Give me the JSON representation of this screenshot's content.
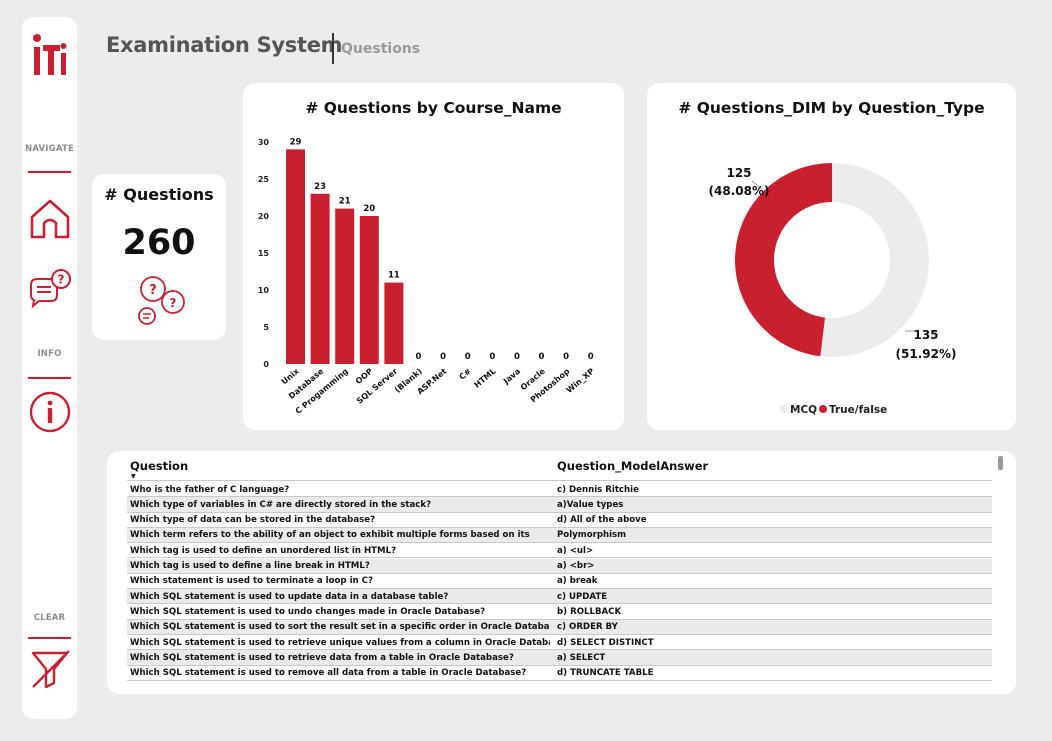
{
  "header": {
    "title": "Examination System",
    "subtitle": "Questions"
  },
  "sidebar": {
    "navigate_label": "NAVIGATE",
    "info_label": "INFO",
    "clear_label": "CLEAR"
  },
  "kpi": {
    "title": "# Questions",
    "value": "260"
  },
  "colors": {
    "accent": "#c8202f",
    "muted": "#ececec",
    "background": "#ececec"
  },
  "chart_data": [
    {
      "type": "bar",
      "title": "# Questions by Course_Name",
      "categories": [
        "Unix",
        "Database",
        "C Progamming",
        "OOP",
        "SQL Server",
        "(Blank)",
        "ASP.Net",
        "C#",
        "HTML",
        "Java",
        "Oracle",
        "Photoshop",
        "Win_XP"
      ],
      "values": [
        29,
        23,
        21,
        20,
        11,
        0,
        0,
        0,
        0,
        0,
        0,
        0,
        0
      ],
      "yticks": [
        0,
        5,
        10,
        15,
        20,
        25,
        30
      ],
      "ylim": [
        0,
        30
      ],
      "color": "#c8202f"
    },
    {
      "type": "pie",
      "title": "# Questions_DIM by Question_Type",
      "categories": [
        "MCQ",
        "True/false"
      ],
      "values": [
        135,
        125
      ],
      "labels": [
        [
          "135",
          "(51.92%)"
        ],
        [
          "125",
          "(48.08%)"
        ]
      ],
      "colors": [
        "#ececec",
        "#c8202f"
      ],
      "legend": "bottom"
    }
  ],
  "table": {
    "columns": [
      "Question",
      "Question_ModelAnswer"
    ],
    "rows": [
      [
        "Who is the father of C language?",
        "c) Dennis Ritchie"
      ],
      [
        "Which type of variables in C# are directly stored in the stack?",
        "a)Value types"
      ],
      [
        "Which type of data can be stored in the database?",
        "d) All of the above"
      ],
      [
        "Which term refers to the ability of an object to exhibit multiple forms based on its",
        "Polymorphism"
      ],
      [
        "Which tag is used to define an unordered list in HTML?",
        "a) <ul>"
      ],
      [
        "Which tag is used to define a line break in HTML?",
        "a) <br>"
      ],
      [
        "Which statement is used to terminate a loop in C?",
        "a) break"
      ],
      [
        "Which SQL statement is used to update data in a database table?",
        "c) UPDATE"
      ],
      [
        "Which SQL statement is used to undo changes made in Oracle Database?",
        "b) ROLLBACK"
      ],
      [
        "Which SQL statement is used to sort the result set in a specific order in Oracle Database?",
        "c) ORDER BY"
      ],
      [
        "Which SQL statement is used to retrieve unique values from a column in Oracle Database?",
        "d) SELECT DISTINCT"
      ],
      [
        "Which SQL statement is used to retrieve data from a table in Oracle Database?",
        "a) SELECT"
      ],
      [
        "Which SQL statement is used to remove all data from a table in Oracle Database?",
        "d) TRUNCATE TABLE"
      ]
    ]
  }
}
